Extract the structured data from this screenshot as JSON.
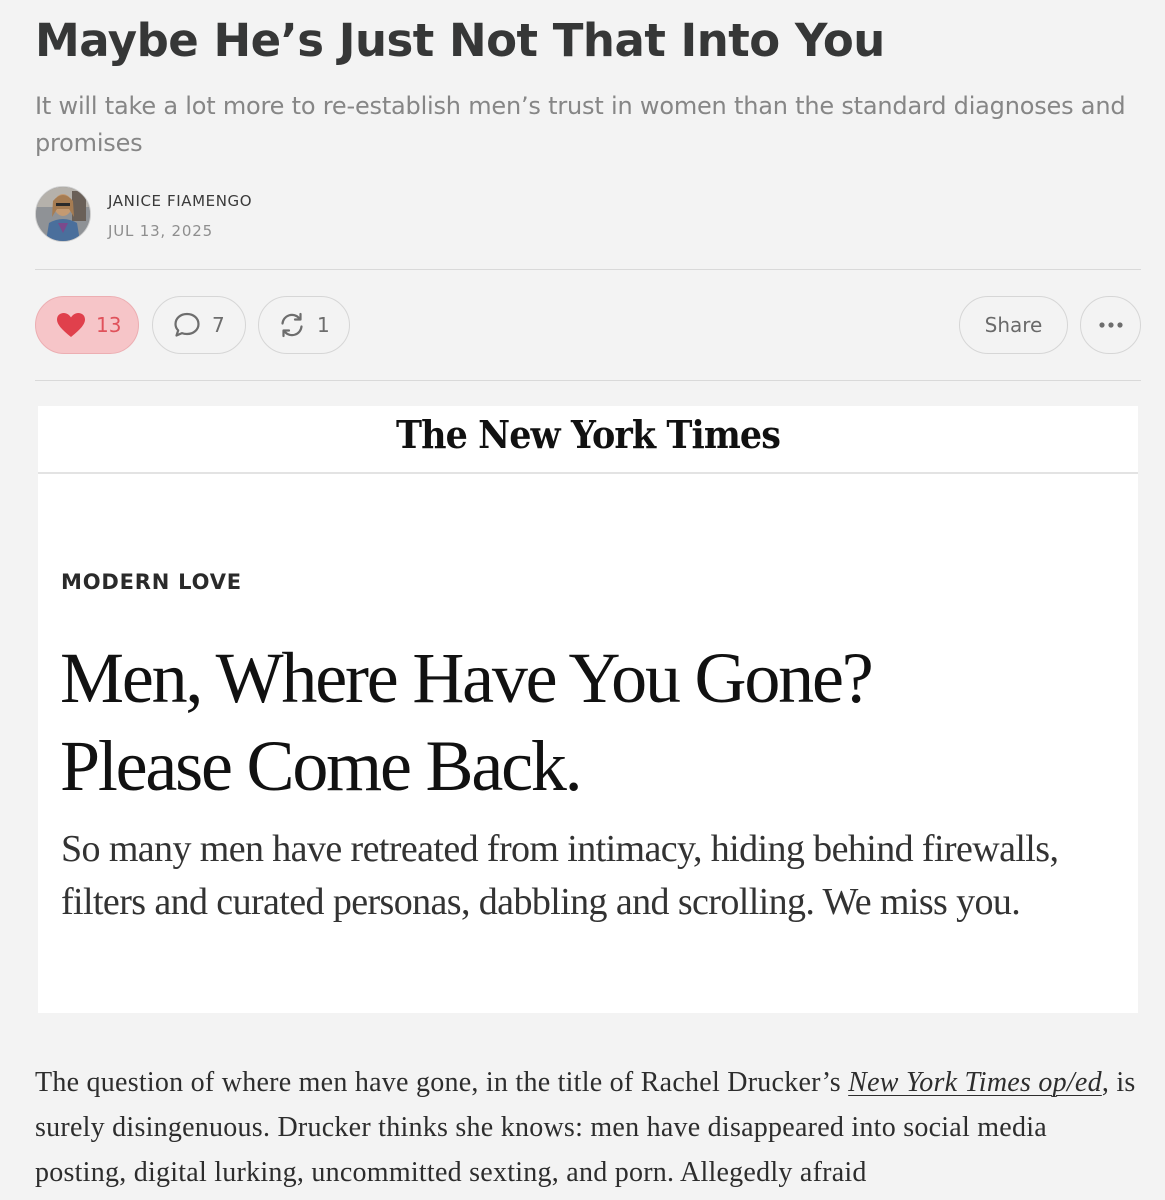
{
  "post": {
    "title": "Maybe He’s Just Not That Into You",
    "subtitle": "It will take a lot more to re-establish men’s trust in women than the standard diagnoses and promises",
    "author": "JANICE FIAMENGO",
    "date": "JUL 13, 2025"
  },
  "actions": {
    "likes": "13",
    "comments": "7",
    "restacks": "1",
    "share_label": "Share",
    "more_icon": "ellipsis-icon",
    "like_icon": "heart-icon",
    "comment_icon": "speech-bubble-icon",
    "restack_icon": "restack-arrows-icon",
    "like_color": "#e0525b",
    "like_bg": "#f6c5c8"
  },
  "embed": {
    "logo": "The New York Times",
    "kicker": "MODERN LOVE",
    "headline_line1": "Men, Where Have You Gone?",
    "headline_line2": "Please Come Back.",
    "dek": "So many men have retreated from intimacy, hiding behind firewalls, filters and curated personas, dabbling and scrolling. We miss you."
  },
  "body": {
    "p1_before_link": "The question of where men have gone, in the title of Rachel Drucker’s ",
    "p1_link": "New York Times op/ed",
    "p1_after_link": ", is surely disingenuous. Drucker thinks she knows: men have disappeared into social media posting, digital lurking, uncommitted sexting, and porn. Allegedly afraid"
  }
}
